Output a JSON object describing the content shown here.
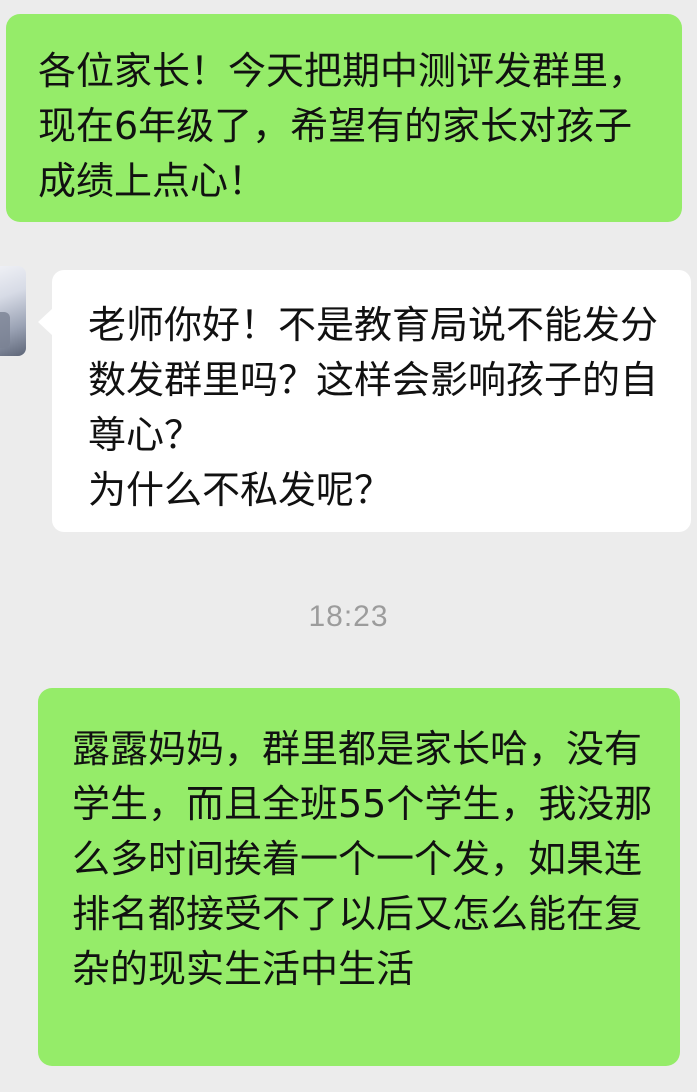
{
  "messages": [
    {
      "direction": "outgoing",
      "text": "各位家长！今天把期中测评发群里，现在6年级了，希望有的家长对孩子成绩上点心！"
    },
    {
      "direction": "incoming",
      "text": "老师你好！不是教育局说不能发分数发群里吗？这样会影响孩子的自尊心？\n为什么不私发呢？"
    },
    {
      "direction": "outgoing",
      "text": "露露妈妈，群里都是家长哈，没有学生，而且全班55个学生，我没那么多时间挨着一个一个发，如果连排名都接受不了以后又怎么能在复杂的现实生活中生活"
    }
  ],
  "timestamp": "18:23",
  "colors": {
    "background": "#ececec",
    "outgoing_bubble": "#95ec69",
    "incoming_bubble": "#ffffff",
    "timestamp_text": "#9c9c9c"
  }
}
